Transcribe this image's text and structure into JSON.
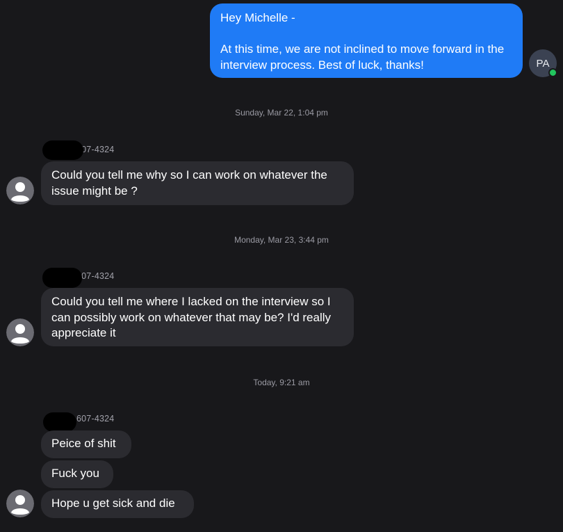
{
  "outgoing": {
    "avatar_initials": "PA",
    "message": "Hey Michelle -\n\nAt this time, we are not inclined to move forward in the interview process. Best of luck, thanks!"
  },
  "groups": [
    {
      "timestamp": "Sunday, Mar 22, 1:04 pm",
      "sender": "607-4324",
      "messages": [
        "Could you tell me why so I can work on whatever the issue might be ?"
      ]
    },
    {
      "timestamp": "Monday, Mar 23, 3:44 pm",
      "sender": "607-4324",
      "messages": [
        "Could you tell me where I lacked on the interview so I can possibly work on whatever that may be? I'd really appreciate it"
      ]
    },
    {
      "timestamp": "Today, 9:21 am",
      "sender": "607-4324",
      "messages": [
        "Peice of shit",
        "Fuck you",
        "Hope u get sick and die"
      ]
    }
  ],
  "colors": {
    "background": "#18181b",
    "outgoing_bubble": "#1f7bf6",
    "incoming_bubble": "#2b2b30",
    "presence_online": "#22c55e"
  },
  "icons": {
    "contact_avatar": "person-silhouette-icon",
    "presence": "online-dot-icon"
  }
}
